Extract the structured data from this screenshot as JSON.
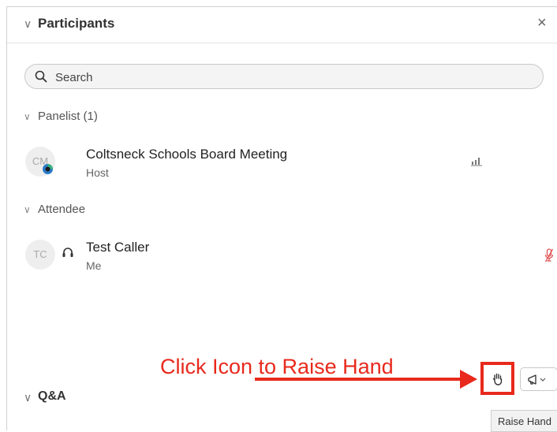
{
  "panel": {
    "title": "Participants",
    "close_glyph": "×",
    "chevron_glyph": "∨"
  },
  "search": {
    "placeholder": "Search",
    "value": ""
  },
  "panelist": {
    "label": "Panelist (1)",
    "items": [
      {
        "initials": "CM",
        "name": "Coltsneck Schools Board Meeting",
        "role": "Host"
      }
    ]
  },
  "attendee": {
    "label": "Attendee",
    "items": [
      {
        "initials": "TC",
        "name": "Test Caller",
        "role": "Me"
      }
    ]
  },
  "annotation": {
    "text": "Click Icon to Raise Hand"
  },
  "qa": {
    "title": "Q&A"
  },
  "tooltip": {
    "text": "Raise Hand"
  },
  "colors": {
    "accent_red": "#e8291c",
    "muted_red": "#e05555"
  },
  "icons": [
    "chevron-down-icon",
    "close-icon",
    "search-icon",
    "audio-signal-icon",
    "headset-icon",
    "muted-mic-icon",
    "raise-hand-icon",
    "megaphone-icon"
  ]
}
